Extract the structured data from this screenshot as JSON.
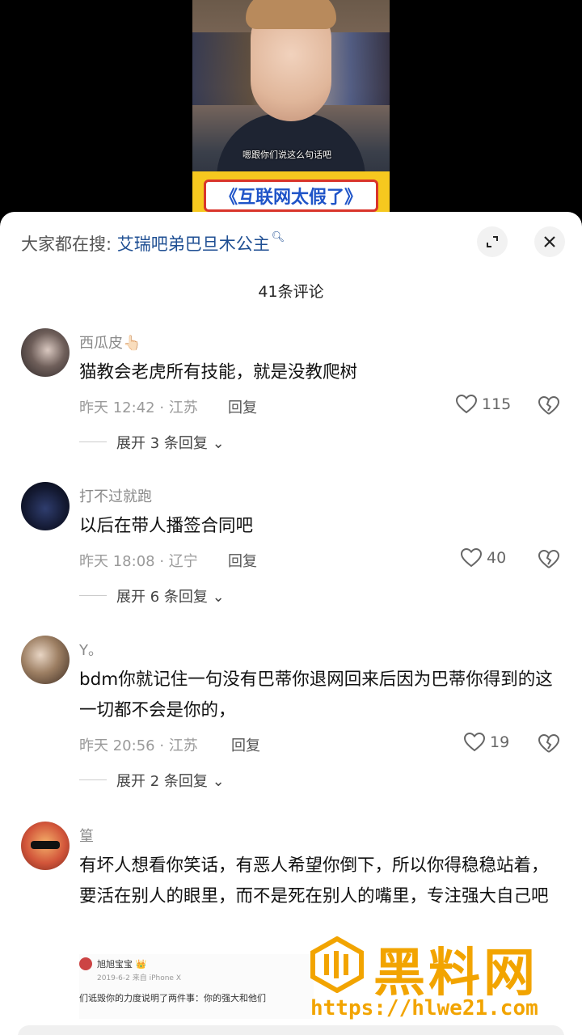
{
  "video": {
    "subtitle": "嗯跟你们说这么句话吧",
    "banner": "《互联网太假了》"
  },
  "header": {
    "search_prefix": "大家都在搜:",
    "search_keyword": "艾瑞吧弟巴旦木公主",
    "comment_count": "41条评论"
  },
  "comments": [
    {
      "name": "西瓜皮👆🏻",
      "text": "猫教会老虎所有技能，就是没教爬树",
      "meta": "昨天 12:42 · 江苏",
      "reply": "回复",
      "likes": "115",
      "expand": "展开 3 条回复"
    },
    {
      "name": "打不过就跑",
      "text": "以后在带人播签合同吧",
      "meta": "昨天 18:08 · 辽宁",
      "reply": "回复",
      "likes": "40",
      "expand": "展开 6 条回复"
    },
    {
      "name": "Y。",
      "text": "bdm你就记住一句没有巴蒂你退网回来后因为巴蒂你得到的这一切都不会是你的，",
      "meta": "昨天 20:56 · 江苏",
      "reply": "回复",
      "likes": "19",
      "expand": "展开 2 条回复"
    },
    {
      "name": "篁",
      "text": "有坏人想看你笑话，有恶人希望你倒下，所以你得稳稳站着，要活在别人的眼里，而不是死在别人的嘴里，专注强大自己吧"
    }
  ],
  "preview": {
    "name": "旭旭宝宝 👑",
    "sub": "2019-6-2 来自 iPhone X",
    "body": "们诋毁你的力度说明了两件事：你的强大和他们"
  },
  "watermark": {
    "title": "黑料网",
    "url": "https://hlwe21.com"
  },
  "colors": {
    "keyword": "#1f4f93",
    "watermark": "#f2a400",
    "banner_bg": "#f6c81f"
  }
}
